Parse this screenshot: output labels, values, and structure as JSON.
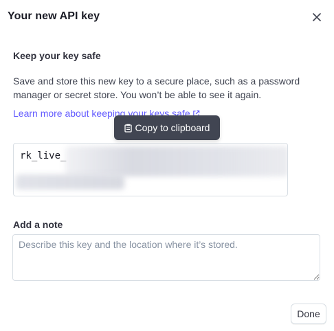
{
  "dialog": {
    "title": "Your new API key",
    "close_icon": "close-icon"
  },
  "safety": {
    "heading": "Keep your key safe",
    "description": "Save and store this new key to a secure place, such as a password manager or secret store. You won’t be able to see it again.",
    "learn_more": "Learn more about keeping your keys safe",
    "external_icon": "external-link-icon"
  },
  "key": {
    "prefix": "rk_live_",
    "redacted_icon": "blurred-secret"
  },
  "tooltip": {
    "label": "Copy to clipboard",
    "icon": "clipboard-icon"
  },
  "note": {
    "label": "Add a note",
    "placeholder": "Describe this key and the location where it’s stored.",
    "value": ""
  },
  "footer": {
    "done_label": "Done"
  },
  "colors": {
    "link": "#635bff",
    "tooltip_bg": "#414552",
    "border": "#d8dee4"
  }
}
